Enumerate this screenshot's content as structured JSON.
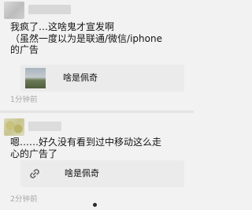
{
  "feed": {
    "posts": [
      {
        "text_lines": [
          "我疯了…这啥鬼才宣发啊",
          "（虽然一度以为是联通/微信/iphone",
          "的广告"
        ],
        "link_title": "啥是佩奇",
        "time": "1分钟前"
      },
      {
        "text_lines": [
          "嗯……好久没有看到过中移动这么走",
          "心的广告了"
        ],
        "link_title": "啥是佩奇",
        "time": "2分钟前"
      }
    ]
  }
}
